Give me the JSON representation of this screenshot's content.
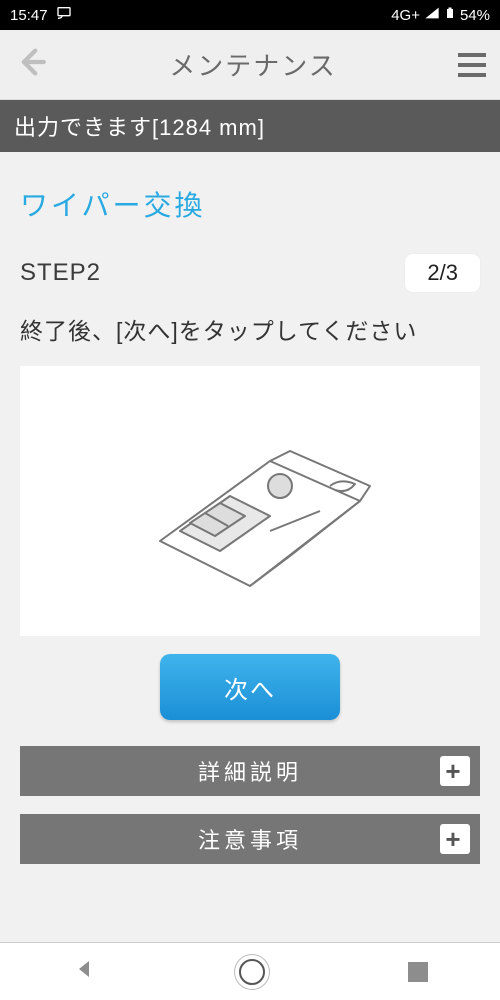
{
  "status": {
    "time": "15:47",
    "network": "4G+",
    "battery": "54%"
  },
  "header": {
    "title": "メンテナンス"
  },
  "banner": {
    "text": "出力できます[1284 mm]"
  },
  "section": {
    "title": "ワイパー交換",
    "step_label": "STEP2",
    "step_progress": "2/3",
    "instruction": "終了後、[次へ]をタップしてください"
  },
  "buttons": {
    "next": "次へ"
  },
  "accordion": {
    "detail": "詳細説明",
    "caution": "注意事項",
    "expand_symbol": "+"
  }
}
